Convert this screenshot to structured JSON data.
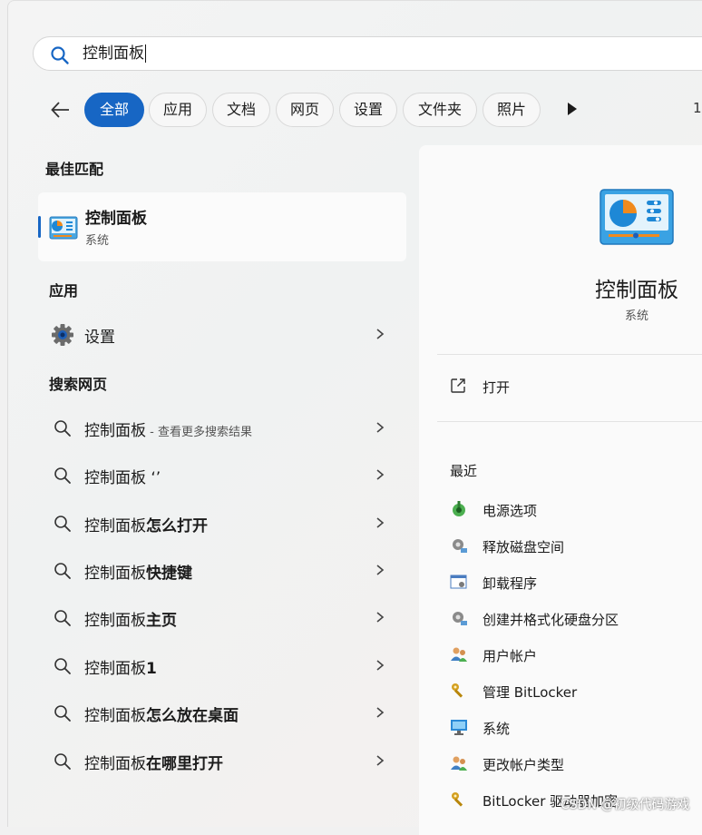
{
  "search": {
    "query": "控制面板"
  },
  "filters": {
    "chips": [
      {
        "label": "全部",
        "active": true
      },
      {
        "label": "应用",
        "active": false
      },
      {
        "label": "文档",
        "active": false
      },
      {
        "label": "网页",
        "active": false
      },
      {
        "label": "设置",
        "active": false
      },
      {
        "label": "文件夹",
        "active": false
      },
      {
        "label": "照片",
        "active": false
      }
    ],
    "count_partial": "1"
  },
  "best_match": {
    "section_title": "最佳匹配",
    "title": "控制面板",
    "subtitle": "系统",
    "icon": "control-panel-icon"
  },
  "apps": {
    "section_title": "应用",
    "items": [
      {
        "label": "设置",
        "icon": "gear-icon"
      }
    ]
  },
  "web": {
    "section_title": "搜索网页",
    "items": [
      {
        "prefix": "控制面板",
        "bold": "",
        "suffix": " - 查看更多搜索结果"
      },
      {
        "prefix": "控制面板 ‘’",
        "bold": "",
        "suffix": ""
      },
      {
        "prefix": "控制面板",
        "bold": "怎么打开",
        "suffix": ""
      },
      {
        "prefix": "控制面板",
        "bold": "快捷键",
        "suffix": ""
      },
      {
        "prefix": "控制面板",
        "bold": "主页",
        "suffix": ""
      },
      {
        "prefix": "控制面板",
        "bold": "1",
        "suffix": ""
      },
      {
        "prefix": "控制面板",
        "bold": "怎么放在桌面",
        "suffix": ""
      },
      {
        "prefix": "控制面板",
        "bold": "在哪里打开",
        "suffix": ""
      }
    ]
  },
  "preview": {
    "title": "控制面板",
    "subtitle": "系统",
    "open_label": "打开",
    "recent_title": "最近",
    "recent": [
      {
        "label": "电源选项",
        "icon": "power-options-icon"
      },
      {
        "label": "释放磁盘空间",
        "icon": "gear-disk-icon"
      },
      {
        "label": "卸载程序",
        "icon": "programs-icon"
      },
      {
        "label": "创建并格式化硬盘分区",
        "icon": "gear-disk-icon"
      },
      {
        "label": "用户帐户",
        "icon": "users-icon"
      },
      {
        "label": "管理 BitLocker",
        "icon": "key-icon"
      },
      {
        "label": "系统",
        "icon": "monitor-icon"
      },
      {
        "label": "更改帐户类型",
        "icon": "users-icon"
      },
      {
        "label": "BitLocker 驱动器加密",
        "icon": "key-icon"
      }
    ]
  },
  "watermark": "CSDN @初级代码游戏",
  "colors": {
    "accent": "#1766c4"
  }
}
